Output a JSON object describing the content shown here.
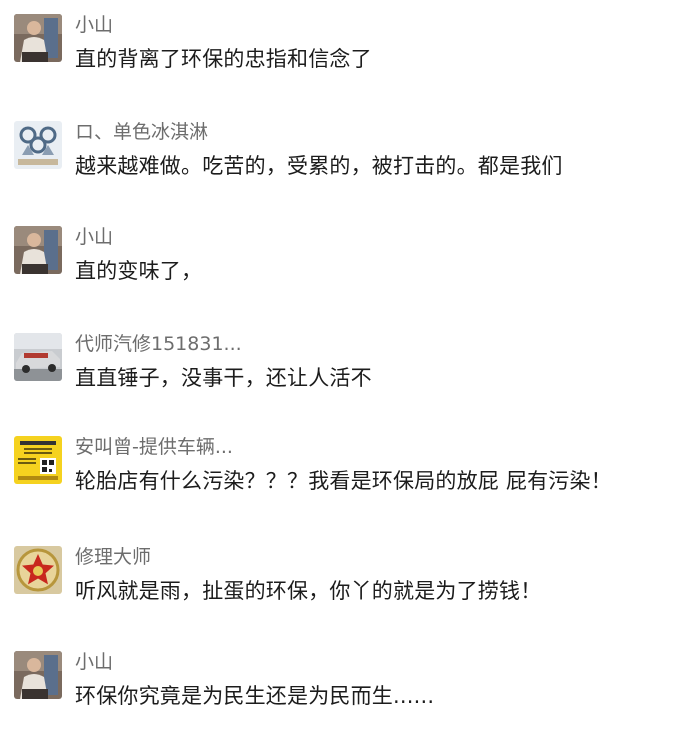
{
  "comments": [
    {
      "author": "小山",
      "avatar_icon": "person-photo-avatar",
      "text": "直的背离了环保的忠指和信念了"
    },
    {
      "author": "ロ、单色冰淇淋",
      "avatar_icon": "cartoon-figures-avatar",
      "text": "越来越难做。吃苦的，受累的，被打击的。都是我们"
    },
    {
      "author": "小山",
      "avatar_icon": "person-photo-avatar",
      "text": "直的变味了，"
    },
    {
      "author": "代师汽修151831...",
      "avatar_icon": "car-photo-avatar",
      "text": "直直锤子，没事干，还让人活不"
    },
    {
      "author": "安叫曾-提供车辆...",
      "avatar_icon": "yellow-qr-poster-avatar",
      "text": "轮胎店有什么污染？？？我看是环保局的放屁 屁有污染！"
    },
    {
      "author": "修理大师",
      "avatar_icon": "red-star-emblem-avatar",
      "text": "听风就是雨，扯蛋的环保，你丫的就是为了捞钱！"
    },
    {
      "author": "小山",
      "avatar_icon": "person-photo-avatar",
      "text": "环保你究竟是为民生还是为民而生......"
    }
  ],
  "colors": {
    "author": "#6d6d6d",
    "text": "#1c1c1c",
    "background": "#ffffff"
  }
}
